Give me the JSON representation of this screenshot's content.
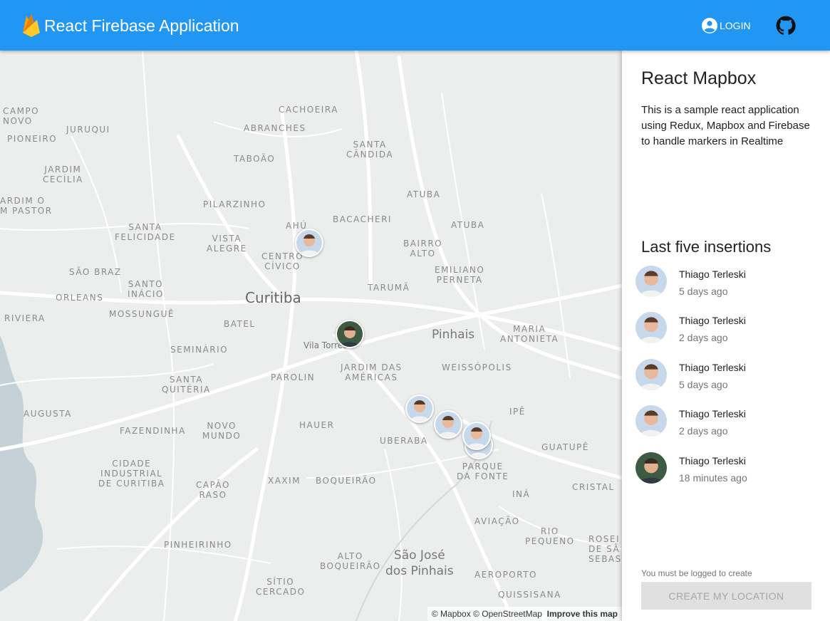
{
  "appbar": {
    "title": "React Firebase Application",
    "login_label": "LOGIN"
  },
  "map": {
    "labels": {
      "campo_novo": "CAMPO\nNOVO",
      "pioneiro": "PIONEIRO",
      "juruqui": "JURUQUI",
      "cachoeira": "CACHOEIRA",
      "abranches": "ABRANCHES",
      "taboao": "TABOÃO",
      "santa_candida": "SANTA\nCÂNDIDA",
      "jardim_cecilia": "JARDIM\nCECÍLIA",
      "atuba1": "ATUBA",
      "atuba2": "ATUBA",
      "pilarzinho": "PILARZINHO",
      "bacacheri": "BACACHERI",
      "jardim_pastor": "ARDIM O\nM PASTOR",
      "ahu": "AHÚ",
      "santa_felicidade": "SANTA\nFELICIDADE",
      "vista_alegre": "VISTA\nALEGRE",
      "bairro_alto": "BAIRRO\nALTO",
      "centro_civico": "CENTRO\nCÍVICO",
      "sao_braz": "SÃO BRAZ",
      "emiliano_perneta": "EMILIANO\nPERNETA",
      "santo_inacio": "SANTO\nINÁCIO",
      "taruma": "TARUMÃ",
      "orleans": "ORLEANS",
      "curitiba": "Curitiba",
      "mossungue": "MOSSUNGUÊ",
      "riviera": "RIVIERA",
      "batel": "BATEL",
      "pinhais": "Pinhais",
      "maria_antonieta": "MARIA\nANTONIETA",
      "vila_torres": "Vila Torres",
      "seminario": "SEMINÁRIO",
      "jardim_americas": "JARDIM DAS\nAMÉRICAS",
      "weissopolis": "WEISSÓPOLIS",
      "santa_quiteria": "SANTA\nQUITÉRIA",
      "parolin": "PAROLIN",
      "augusta": "AUGUSTA",
      "ipe": "IPÊ",
      "hauer": "HAUER",
      "novo_mundo": "NOVO\nMUNDO",
      "fazendinha": "FAZENDINHA",
      "uberaba": "UBERABA",
      "guatupe": "GUATUPÊ",
      "cidade_industrial": "CIDADE\nINDUSTRIAL\nDE CURITIBA",
      "parque_fonte": "PARQUE\nDA FONTE",
      "xaxim": "XAXIM",
      "boqueirao": "BOQUEIRÃO",
      "capao_raso": "CAPÃO\nRASO",
      "cristal": "CRISTAL",
      "ina": "INÁ",
      "aviacao": "AVIAÇÃO",
      "rio_pequeno": "RIO\nPEQUENO",
      "pinheirinho": "PINHEIRINHO",
      "rosei": "ROSEI\nDE SÃ\nSEBAST",
      "alto_boqueirao": "ALTO\nBOQUEIRÃO",
      "sao_jose": "São José\ndos Pinhais",
      "aeroporto": "AEROPORTO",
      "sitio_cercado": "SÍTIO\nCERCADO",
      "quissisana": "QUISSISANA"
    },
    "attribution": {
      "mapbox": "© Mapbox",
      "osm": "© OpenStreetMap",
      "improve": "Improve this map"
    }
  },
  "panel": {
    "title": "React Mapbox",
    "description": "This is a sample react application using Redux, Mapbox and Firebase to handle markers in Realtime",
    "section_title": "Last five insertions",
    "insertions": [
      {
        "name": "Thiago Terleski",
        "time": "5 days ago"
      },
      {
        "name": "Thiago Terleski",
        "time": "2 days ago"
      },
      {
        "name": "Thiago Terleski",
        "time": "5 days ago"
      },
      {
        "name": "Thiago Terleski",
        "time": "2 days ago"
      },
      {
        "name": "Thiago Terleski",
        "time": "18 minutes ago"
      }
    ],
    "login_hint": "You must be logged to create",
    "cta_label": "CREATE MY LOCATION"
  },
  "colors": {
    "appbar": "#2196f3",
    "map_background": "#eceeed",
    "water": "#c4d1d6",
    "button_disabled": "#e0e0e0"
  }
}
